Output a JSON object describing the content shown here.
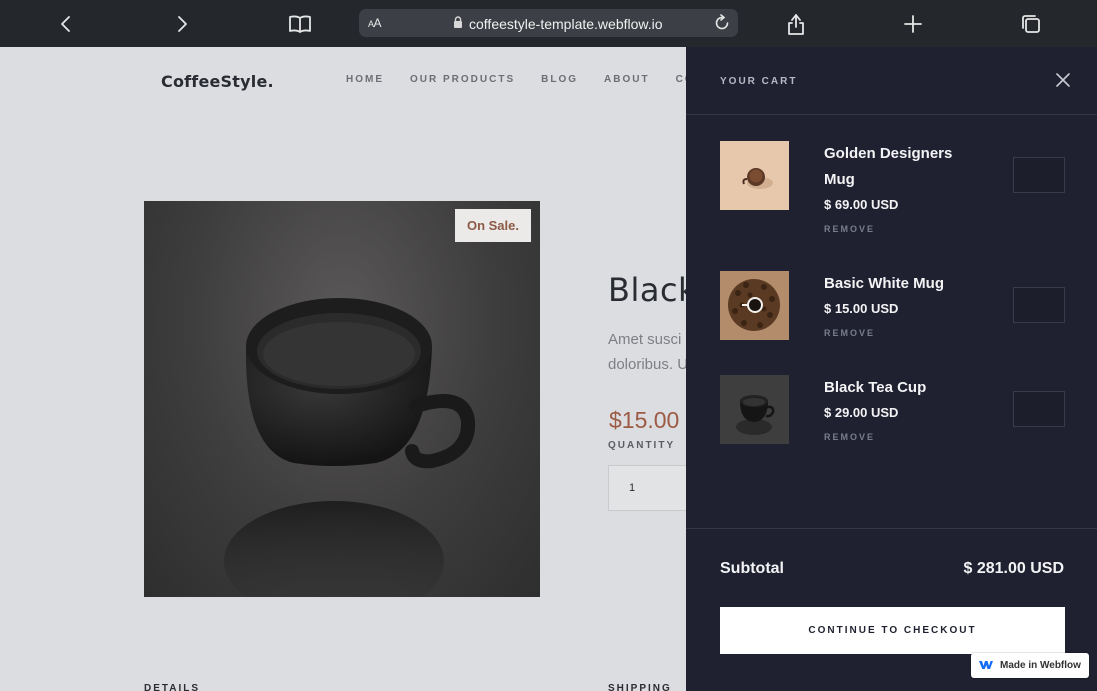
{
  "browser": {
    "text_size_label": "AA",
    "url": "coffeestyle-template.webflow.io"
  },
  "site": {
    "logo": "CoffeeStyle.",
    "nav": [
      "HOME",
      "OUR PRODUCTS",
      "BLOG",
      "ABOUT",
      "CONT"
    ],
    "product": {
      "badge": "On Sale.",
      "title": "Black",
      "description_line1": "Amet susci",
      "description_line2": "doloribus. U",
      "price": "$15.00",
      "quantity_label": "QUANTITY",
      "quantity_value": "1"
    },
    "bottom_left": "DETAILS",
    "bottom_right": "SHIPPING"
  },
  "cart": {
    "title": "YOUR CART",
    "items": [
      {
        "name": "Golden Designers Mug",
        "price": "$ 69.00 USD",
        "remove": "REMOVE",
        "qty": ""
      },
      {
        "name": "Basic White Mug",
        "price": "$ 15.00 USD",
        "remove": "REMOVE",
        "qty": ""
      },
      {
        "name": "Black Tea Cup",
        "price": "$ 29.00 USD",
        "remove": "REMOVE",
        "qty": ""
      }
    ],
    "subtotal_label": "Subtotal",
    "subtotal_value": "$ 281.00 USD",
    "checkout_label": "CONTINUE TO CHECKOUT"
  },
  "badge": {
    "label": "Made in Webflow"
  },
  "colors": {
    "page_bg": "#dcdde0",
    "cart_bg": "#1f2130",
    "price_accent": "#9d5a45",
    "chrome_bg": "#24282d"
  },
  "icons": [
    "back-icon",
    "forward-icon",
    "book-icon",
    "lock-icon",
    "reload-icon",
    "share-icon",
    "plus-icon",
    "tabs-icon",
    "close-icon",
    "webflow-logo-icon"
  ]
}
